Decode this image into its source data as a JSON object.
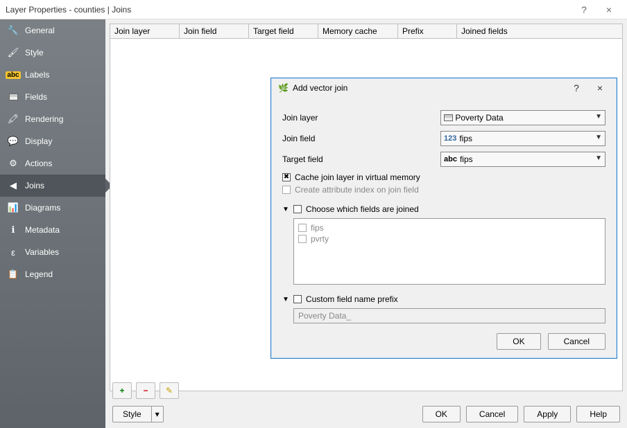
{
  "window": {
    "title": "Layer Properties - counties | Joins",
    "help": "?",
    "close": "×"
  },
  "sidebar": {
    "items": [
      {
        "label": "General",
        "icon": "🔧"
      },
      {
        "label": "Style",
        "icon": "🖌"
      },
      {
        "label": "Labels",
        "iconHtml": "abc"
      },
      {
        "label": "Fields",
        "iconHtml": "tbl"
      },
      {
        "label": "Rendering",
        "icon": "🖍"
      },
      {
        "label": "Display",
        "icon": "💬"
      },
      {
        "label": "Actions",
        "icon": "⚙"
      },
      {
        "label": "Joins",
        "icon": "◀"
      },
      {
        "label": "Diagrams",
        "icon": "📊"
      },
      {
        "label": "Metadata",
        "icon": "ℹ"
      },
      {
        "label": "Variables",
        "icon": "ε"
      },
      {
        "label": "Legend",
        "icon": "📋"
      }
    ],
    "activeIndex": 7
  },
  "joinsTable": {
    "columns": [
      "Join layer",
      "Join field",
      "Target field",
      "Memory cache",
      "Prefix",
      "Joined fields"
    ]
  },
  "toolbar": {
    "add": "+",
    "remove": "−",
    "edit": "✎"
  },
  "footer": {
    "style": "Style",
    "ok": "OK",
    "cancel": "Cancel",
    "apply": "Apply",
    "help": "Help"
  },
  "dialog": {
    "title": "Add vector join",
    "help": "?",
    "close": "×",
    "labels": {
      "joinLayer": "Join layer",
      "joinField": "Join field",
      "targetField": "Target field",
      "cache": "Cache join layer in virtual memory",
      "createIndex": "Create attribute index on join field",
      "chooseFields": "Choose which fields are joined",
      "customPrefix": "Custom field name prefix"
    },
    "values": {
      "joinLayer": "Poverty Data",
      "joinFieldPrefix": "123",
      "joinField": "fips",
      "targetFieldPrefix": "abc",
      "targetField": "fips",
      "prefix": "Poverty Data_"
    },
    "fields": [
      "fips",
      "pvrty"
    ],
    "checked": {
      "cache": true,
      "createIndex": false,
      "chooseFields": false,
      "customPrefix": false
    },
    "ok": "OK",
    "cancel": "Cancel"
  }
}
